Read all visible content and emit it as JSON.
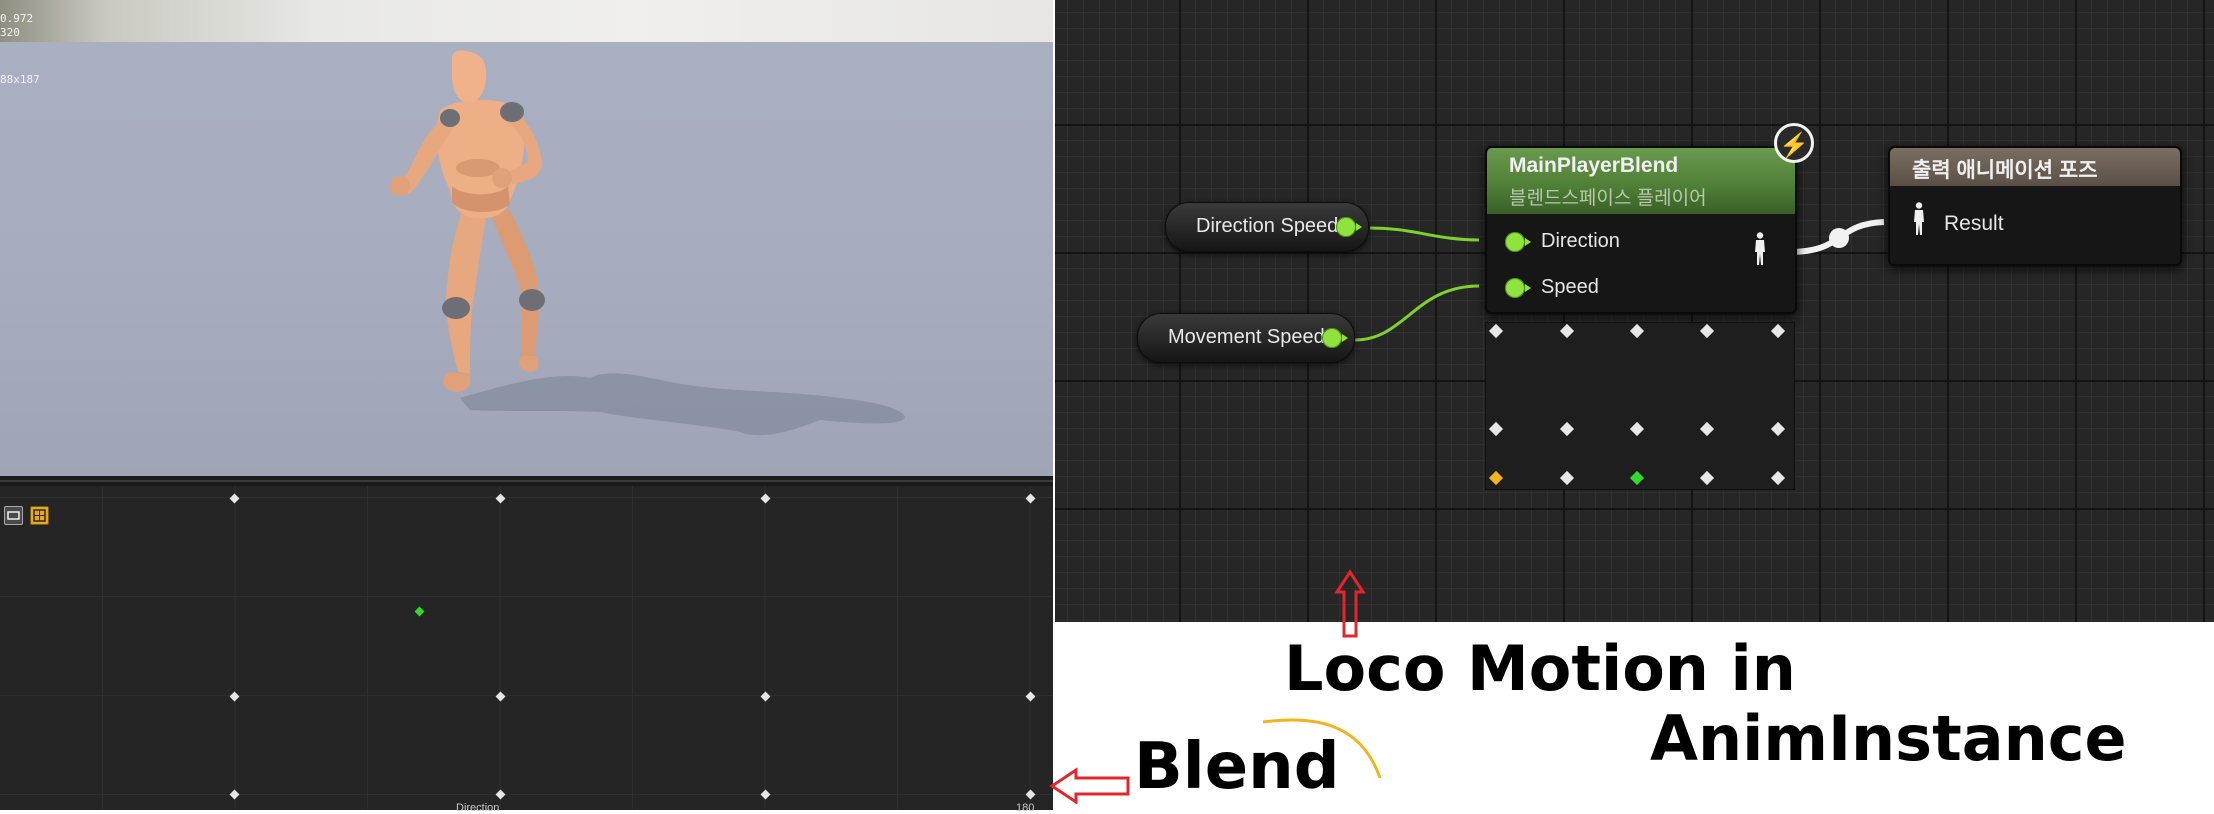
{
  "viewport": {
    "stats": [
      "0.972",
      "320",
      "",
      "88x187"
    ],
    "colors": {
      "floor": "#a7adbe",
      "mannequin": "#e7a77f"
    }
  },
  "blend_space": {
    "toolbar_icons": [
      "frame-icon",
      "grid-icon"
    ],
    "axis_label": "Direction",
    "axis_max_label": "180",
    "sample_point_color": "#2fd92f"
  },
  "graph": {
    "nodes": {
      "direction_speed": {
        "label": "Direction Speed"
      },
      "movement_speed": {
        "label": "Movement Speed"
      },
      "blendspace_player": {
        "title": "MainPlayerBlend",
        "subtitle": "블렌드스페이스 플레이어",
        "inputs": [
          "Direction",
          "Speed"
        ]
      },
      "output_pose": {
        "title": "출력 애니메이션 포즈",
        "input": "Result"
      }
    },
    "colors": {
      "float_pin": "#8ee33d",
      "blend_header": "#5e8c44",
      "result_header": "#6b5f54"
    }
  },
  "annotations": {
    "title_line1": "Loco Motion in",
    "title_line2": "AnimInstance",
    "blend_label": "Blend",
    "arrow_color": "#e3262b",
    "curve_color": "#f2b41c"
  }
}
